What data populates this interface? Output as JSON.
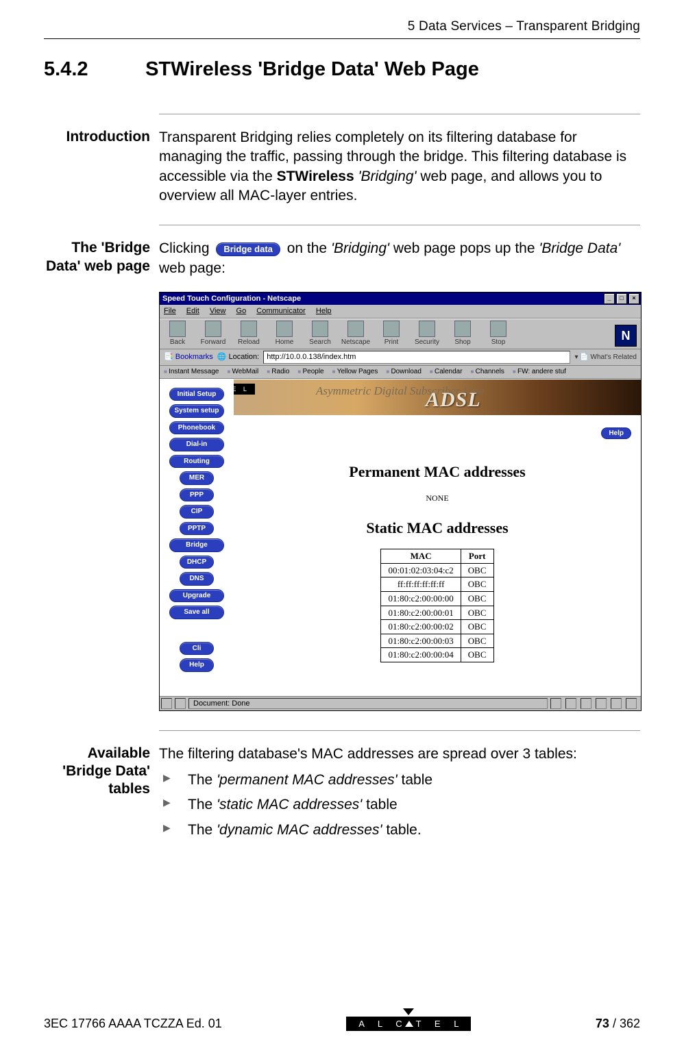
{
  "runningHead": "5  Data Services – Transparent Bridging",
  "heading": {
    "number": "5.4.2",
    "title": "STWireless 'Bridge Data' Web Page"
  },
  "sections": {
    "intro": {
      "label": "Introduction",
      "text_pre": "Transparent Bridging relies completely on its filtering database for managing the traffic, passing through the bridge. This filtering database is accessible via the ",
      "bold": "STWireless",
      "italic": " 'Bridging' ",
      "text_post": "web page, and allows you to overview all MAC-layer entries."
    },
    "bridgeData": {
      "label": "The 'Bridge Data' web page",
      "pre": "Clicking ",
      "button": "Bridge data",
      "mid": " on the ",
      "italic1": "'Bridging'",
      "mid2": " web page pops up the ",
      "italic2": "'Bridge Data'",
      "post": " web page:"
    },
    "available": {
      "label": "Available 'Bridge Data' tables",
      "lead": "The filtering database's MAC addresses are spread over 3 tables:",
      "items": [
        {
          "pre": "The ",
          "italic": "'permanent MAC addresses'",
          "post": " table"
        },
        {
          "pre": "The ",
          "italic": "'static MAC addresses'",
          "post": " table"
        },
        {
          "pre": "The ",
          "italic": "'dynamic MAC addresses'",
          "post": " table."
        }
      ]
    }
  },
  "screenshot": {
    "title": "Speed Touch Configuration - Netscape",
    "menus": [
      "File",
      "Edit",
      "View",
      "Go",
      "Communicator",
      "Help"
    ],
    "toolbar": [
      "Back",
      "Forward",
      "Reload",
      "Home",
      "Search",
      "Netscape",
      "Print",
      "Security",
      "Shop",
      "Stop"
    ],
    "bookmarksLabel": "Bookmarks",
    "locationLabel": "Location:",
    "locationValue": "http://10.0.0.138/index.htm",
    "whatsRelated": "What's Related",
    "personal": [
      "Instant Message",
      "WebMail",
      "Radio",
      "People",
      "Yellow Pages",
      "Download",
      "Calendar",
      "Channels",
      "FW: andere stuf"
    ],
    "banner": {
      "alcatel": "A L C A T E L",
      "asym": "Asymmetric Digital Subscriber Line",
      "adsl": "ADSL"
    },
    "sidebar": {
      "top": [
        "Initial Setup",
        "System setup",
        "Phonebook",
        "Dial-in",
        "Routing"
      ],
      "narrow": [
        "MER",
        "PPP",
        "CIP",
        "PPTP"
      ],
      "mid": [
        "Bridge"
      ],
      "narrow2": [
        "DHCP",
        "DNS"
      ],
      "mid2": [
        "Upgrade",
        "Save all"
      ],
      "bottom": [
        "Cli",
        "Help"
      ]
    },
    "helpButton": "Help",
    "headings": {
      "permanent": "Permanent MAC addresses",
      "none": "NONE",
      "static": "Static MAC addresses"
    },
    "table": {
      "headers": [
        "MAC",
        "Port"
      ],
      "rows": [
        [
          "00:01:02:03:04:c2",
          "OBC"
        ],
        [
          "ff:ff:ff:ff:ff:ff",
          "OBC"
        ],
        [
          "01:80:c2:00:00:00",
          "OBC"
        ],
        [
          "01:80:c2:00:00:01",
          "OBC"
        ],
        [
          "01:80:c2:00:00:02",
          "OBC"
        ],
        [
          "01:80:c2:00:00:03",
          "OBC"
        ],
        [
          "01:80:c2:00:00:04",
          "OBC"
        ]
      ]
    },
    "status": "Document: Done"
  },
  "footer": {
    "docnum": "3EC 17766 AAAA TCZZA Ed. 01",
    "logoText": "A L C",
    "logoText2": "T E L",
    "pageCurrent": "73",
    "pageTotal": " / 362"
  }
}
